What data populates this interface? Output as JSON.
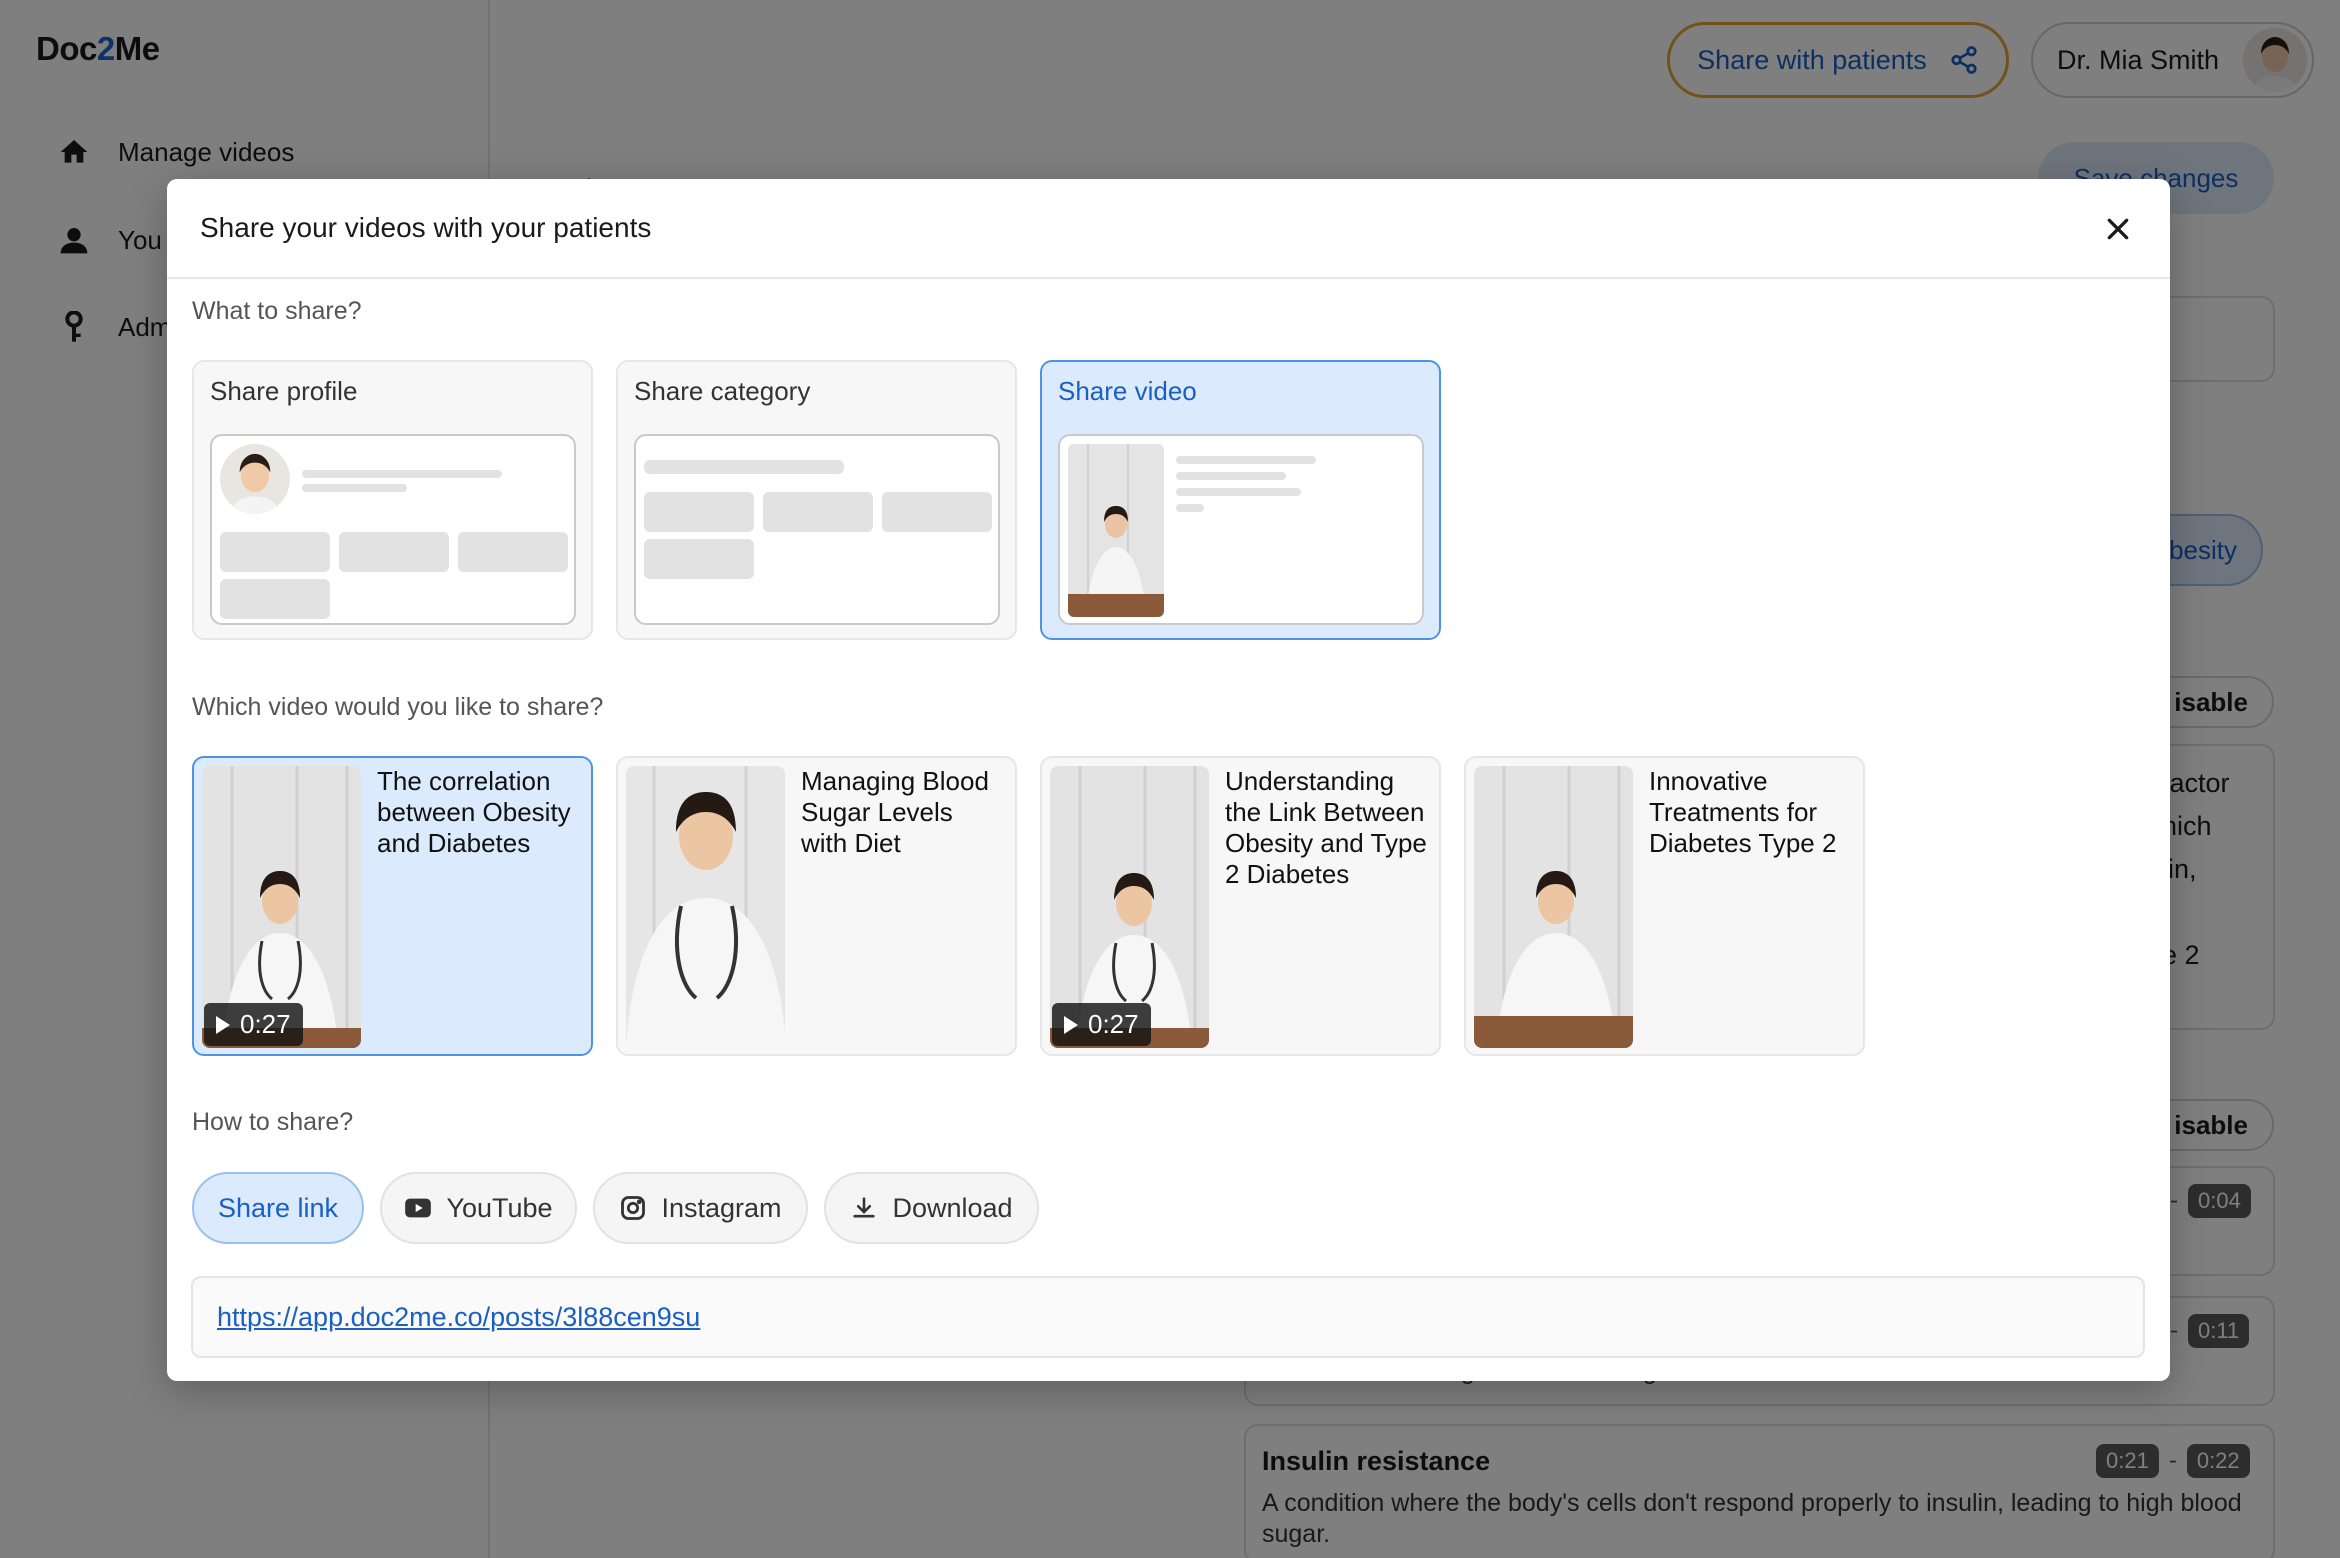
{
  "app": {
    "logo_prefix": "Doc",
    "logo_accent": "2",
    "logo_suffix": "Me",
    "nav": [
      {
        "label": "Manage videos",
        "icon": "home-icon"
      },
      {
        "label": "You",
        "icon": "user-icon"
      },
      {
        "label": "Adm",
        "icon": "key-icon"
      }
    ],
    "share_button": "Share with patients",
    "user_name": "Dr. Mia Smith",
    "save_changes": "Save changes",
    "category_pill": "besity",
    "disable_1": "isable",
    "disable_2": "isable",
    "bg_text_lines": [
      "factor",
      "hich",
      "lin,",
      "",
      "e 2"
    ],
    "timestamps": [
      {
        "start": "",
        "end": "0:04"
      },
      {
        "start": "",
        "end": "0:11"
      },
      {
        "start": "0:21",
        "end": "0:22"
      }
    ],
    "term_title": "Insulin resistance",
    "term_desc": "A condition where the body's cells don't respond properly to insulin, leading to high blood sugar.",
    "partial_desc": "A hormone that regulates blood sugar levels."
  },
  "modal": {
    "title": "Share your videos with your patients",
    "what_label": "What to share?",
    "options": [
      {
        "label": "Share profile",
        "selected": false
      },
      {
        "label": "Share category",
        "selected": false
      },
      {
        "label": "Share video",
        "selected": true
      }
    ],
    "which_label": "Which video would you like to share?",
    "videos": [
      {
        "title": "The correlation between Obesity and Diabetes",
        "duration": "0:27",
        "selected": true
      },
      {
        "title": "Managing Blood Sugar Levels with Diet",
        "duration": "",
        "selected": false
      },
      {
        "title": "Understanding the Link Between Obesity and Type 2 Diabetes",
        "duration": "0:27",
        "selected": false
      },
      {
        "title": "Innovative Treatments for Diabetes Type 2",
        "duration": "",
        "selected": false
      }
    ],
    "how_label": "How to share?",
    "methods": [
      {
        "label": "Share link",
        "icon": "",
        "selected": true
      },
      {
        "label": "YouTube",
        "icon": "youtube-icon",
        "selected": false
      },
      {
        "label": "Instagram",
        "icon": "instagram-icon",
        "selected": false
      },
      {
        "label": "Download",
        "icon": "download-icon",
        "selected": false
      }
    ],
    "link": "https://app.doc2me.co/posts/3l88cen9su"
  }
}
